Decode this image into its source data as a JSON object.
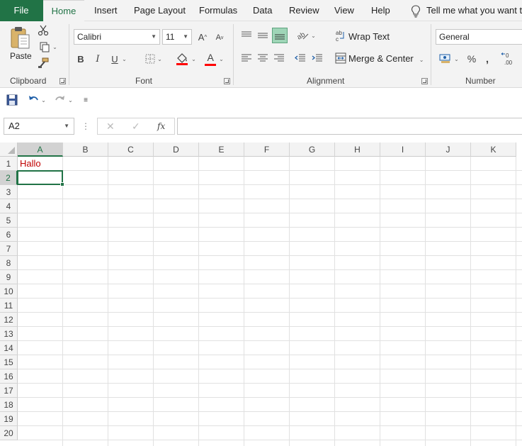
{
  "tabs": {
    "file": "File",
    "home": "Home",
    "insert": "Insert",
    "page_layout": "Page Layout",
    "formulas": "Formulas",
    "data": "Data",
    "review": "Review",
    "view": "View",
    "help": "Help",
    "tell_me": "Tell me what you want to"
  },
  "ribbon": {
    "clipboard": {
      "label": "Clipboard",
      "paste": "Paste"
    },
    "font": {
      "label": "Font",
      "family": "Calibri",
      "size": "11",
      "bold": "B",
      "italic": "I",
      "underline": "U",
      "grow": "A",
      "shrink": "A",
      "font_color_letter": "A",
      "fill_color": "#ff0000",
      "font_color": "#ff0000"
    },
    "alignment": {
      "label": "Alignment",
      "wrap_text": "Wrap Text",
      "merge_center": "Merge & Center"
    },
    "number": {
      "label": "Number",
      "format": "General",
      "percent": "%",
      "comma": ",",
      "decimals": "←0\n.00"
    }
  },
  "formula_bar": {
    "name_box": "A2",
    "fx": "fx",
    "formula": ""
  },
  "grid": {
    "columns": [
      "A",
      "B",
      "C",
      "D",
      "E",
      "F",
      "G",
      "H",
      "I",
      "J",
      "K"
    ],
    "rows": [
      "1",
      "2",
      "3",
      "4",
      "5",
      "6",
      "7",
      "8",
      "9",
      "10",
      "11",
      "12",
      "13",
      "14",
      "15",
      "16",
      "17",
      "18",
      "19",
      "20"
    ],
    "active_column": "A",
    "active_row": "2",
    "cells": {
      "A1": "Hallo"
    },
    "accent": "#217346",
    "cell_text_color": "#c00000"
  }
}
